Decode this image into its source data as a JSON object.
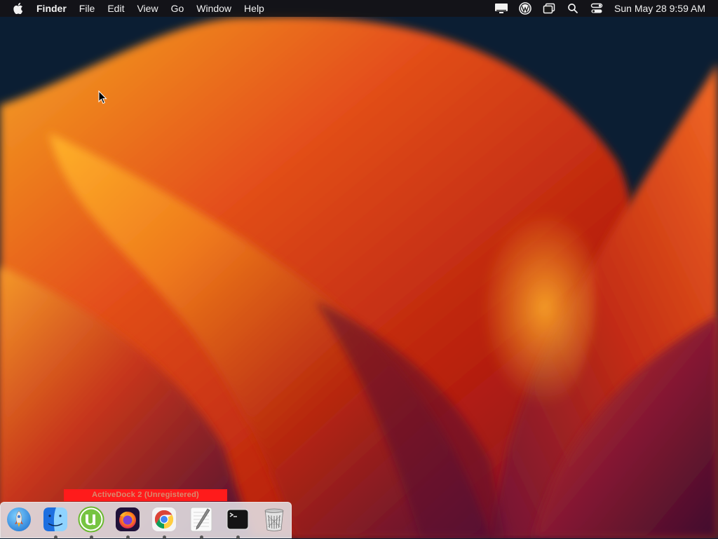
{
  "menubar": {
    "apple_icon": "apple-logo-icon",
    "app_name": "Finder",
    "menus": [
      "File",
      "Edit",
      "View",
      "Go",
      "Window",
      "Help"
    ],
    "status_icons": [
      "display-icon",
      "wordpress-icon",
      "screens-icon",
      "search-icon",
      "control-center-icon"
    ],
    "clock": "Sun May 28  9:59 AM"
  },
  "dock": {
    "banner": "ActiveDock 2 (Unregistered)",
    "items": [
      {
        "name": "Launchpad",
        "icon": "rocket-icon",
        "running": false
      },
      {
        "name": "Finder",
        "icon": "finder-icon",
        "running": true
      },
      {
        "name": "uTorrent",
        "icon": "utorrent-icon",
        "running": true
      },
      {
        "name": "Firefox",
        "icon": "firefox-icon",
        "running": true
      },
      {
        "name": "Chrome",
        "icon": "chrome-icon",
        "running": true
      },
      {
        "name": "TextEdit",
        "icon": "textedit-icon",
        "running": true
      },
      {
        "name": "Terminal",
        "icon": "terminal-icon",
        "running": true
      },
      {
        "name": "Trash",
        "icon": "trash-icon",
        "running": false
      }
    ]
  },
  "colors": {
    "wallpaper_dark": "#0b1e33",
    "wallpaper_orange": "#f08a1c",
    "wallpaper_red": "#c8290f",
    "wallpaper_purple": "#6a1a48",
    "banner_red": "#ff1b1b"
  }
}
